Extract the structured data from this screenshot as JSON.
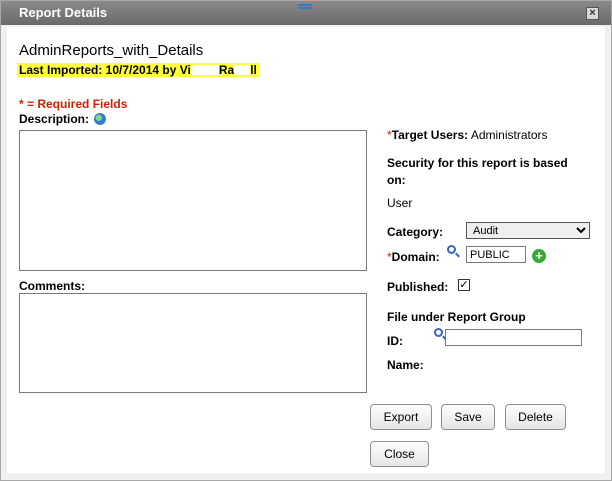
{
  "window": {
    "title": "Report Details",
    "close_glyph": "×"
  },
  "report": {
    "name": "AdminReports_with_Details",
    "last_imported": "Last Imported: 10/7/2014 by Vi",
    "imported_by_tail1": "Ra",
    "imported_by_tail2": "ll"
  },
  "form": {
    "required_note": "* = Required Fields",
    "description_label": "Description:",
    "comments_label": "Comments:",
    "required_marker": "*",
    "target_users_label": "Target Users:",
    "target_users_value": "Administrators",
    "security_text": "Security for this report is based on:",
    "security_value": "User",
    "category_label": "Category:",
    "category_value": "Audit",
    "domain_label": "Domain:",
    "domain_value": "PUBLIC",
    "published_label": "Published:",
    "published_checked": true,
    "checkmark": "✓",
    "add_glyph": "+",
    "file_under_label": "File under Report Group",
    "id_label": "ID:",
    "name_label": "Name:"
  },
  "buttons": {
    "export": "Export",
    "save": "Save",
    "delete": "Delete",
    "close": "Close"
  },
  "icons": [
    "globe-icon",
    "search-icon",
    "add-icon",
    "close-icon",
    "drag-handle-icon"
  ],
  "colors": {
    "title_bar": "#7a7a7a",
    "required": "#cc2200",
    "highlight": "#ffff40",
    "add_icon": "#38a838"
  }
}
